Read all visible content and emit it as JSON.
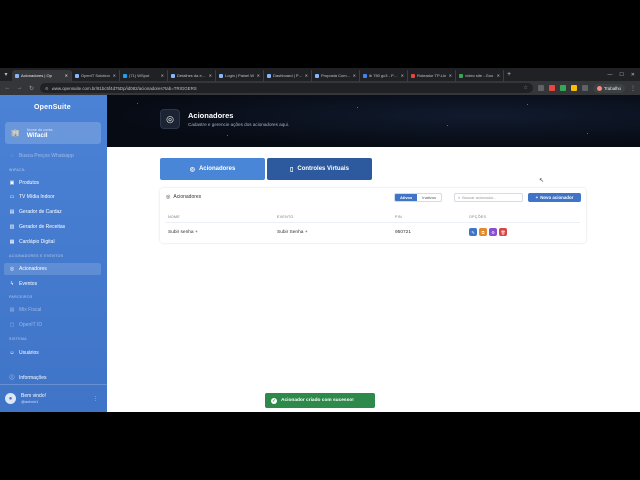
{
  "browser": {
    "tabs": [
      {
        "label": "Acionadores | Op",
        "active": true
      },
      {
        "label": "OpenIT Solution"
      },
      {
        "label": "(71) WSpot"
      },
      {
        "label": "Detalhes da emp"
      },
      {
        "label": "Login | Painel W"
      },
      {
        "label": "Dashboard | Pain"
      },
      {
        "label": "Proposta Comerc"
      },
      {
        "label": "ib 750 gc3 - Pesq"
      },
      {
        "label": "Roteador TP-Lin"
      },
      {
        "label": "vídeo site - Goo"
      }
    ],
    "url": "www.opensuite.com.br/81bc5f4d75Dp/id082/acionadores?tab=TRIGGERS",
    "profile": "Trabalho"
  },
  "sidebar": {
    "logo": "OpenSuite",
    "company_label": "Nome da conta",
    "company_name": "Wifacil",
    "quick": "Busca Preços Whatsapp",
    "sections": {
      "wifacil": "WIFACIL",
      "acionadores": "ACIONADORES E EVENTOS",
      "parceiros": "PARCEIROS",
      "sistema": "SISTEMA"
    },
    "items": {
      "produtos": "Produtos",
      "tv": "TV Mídia Indoor",
      "cardaz": "Gerador de Cardaz",
      "receitas": "Gerador de Receitas",
      "cardapio": "Cardápio Digital",
      "acionadores": "Acionadores",
      "eventos": "Eventos",
      "mix": "Mix Fiscal",
      "openit": "OpenIT ID",
      "usuarios": "Usuários",
      "informacoes": "Informações"
    },
    "user_name": "Bem vindo!",
    "user_mail": "@admin1"
  },
  "header": {
    "title": "Acionadores",
    "subtitle": "Cadastre e gerencie ações dos acionadores aqui."
  },
  "content": {
    "btn_acionadores": "Acionadores",
    "btn_controles": "Controles Virtuais",
    "card_title": "Acionadores",
    "seg_ativos": "Ativos",
    "seg_inativos": "Inativos",
    "search_placeholder": "Buscar acionador...",
    "new_button": "Novo acionador",
    "columns": {
      "nome": "NOME",
      "evento": "EVENTO",
      "pin": "PIN",
      "opcoes": "OPÇÕES"
    },
    "row": {
      "nome": "Subir senha +",
      "evento": "Subir Senha +",
      "pin": "950721"
    },
    "action_colors": [
      "#3f74c7",
      "#e08a2c",
      "#8a4fd0",
      "#d64545"
    ]
  },
  "toast": "Acionador criado com sucesso!"
}
